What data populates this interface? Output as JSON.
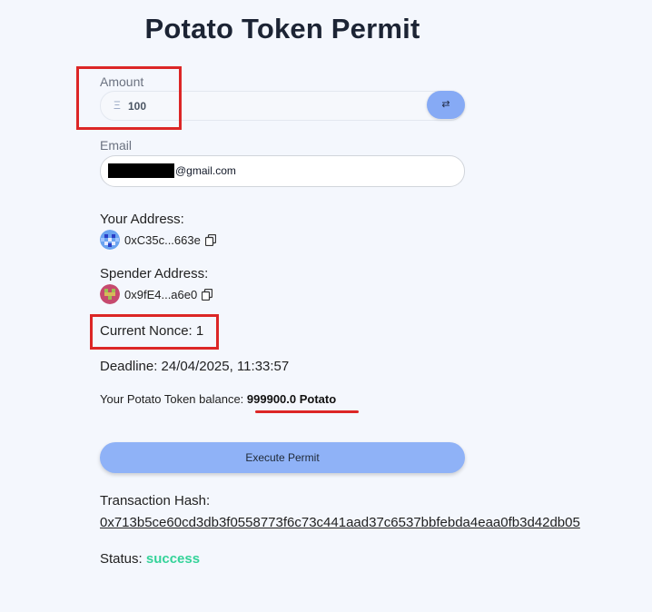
{
  "title": "Potato Token Permit",
  "amount": {
    "label": "Amount",
    "symbol": "Ξ",
    "value": "100",
    "swap_icon": "swap-icon"
  },
  "email": {
    "label": "Email",
    "value": "@gmail.com"
  },
  "your_address": {
    "heading": "Your Address:",
    "value": "0xC35c...663e"
  },
  "spender_address": {
    "heading": "Spender Address:",
    "value": "0x9fE4...a6e0"
  },
  "nonce": {
    "text": "Current Nonce: 1"
  },
  "deadline": {
    "text": "Deadline: 24/04/2025, 11:33:57"
  },
  "balance": {
    "prefix": "Your Potato Token balance: ",
    "amount": "999900.0 Potato"
  },
  "execute_button": "Execute Permit",
  "transaction": {
    "heading": "Transaction Hash:",
    "hash": "0x713b5ce60cd3db3f0558773f6c73c441aad37c6537bbfebda4eaa0fb3d42db05"
  },
  "status": {
    "label": "Status: ",
    "value": "success"
  },
  "colors": {
    "accent": "#86aaf5",
    "highlight": "#dc2626",
    "success": "#34d399"
  }
}
